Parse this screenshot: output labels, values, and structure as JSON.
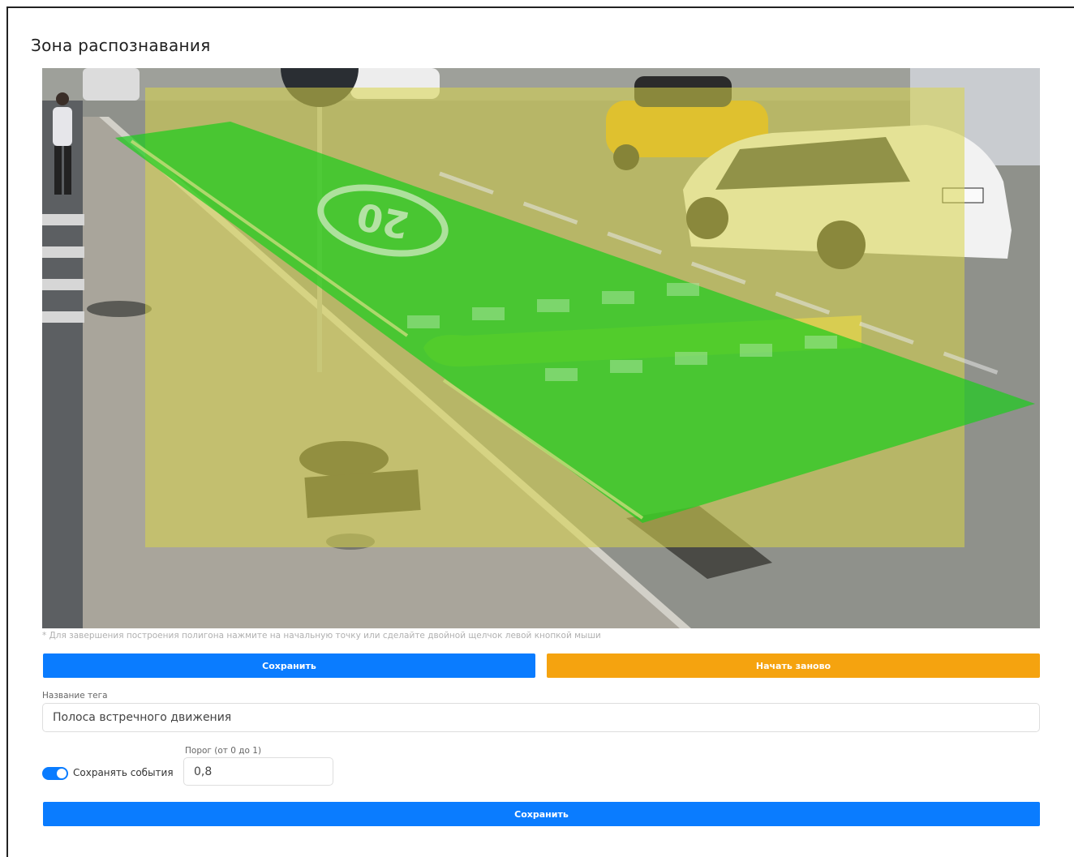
{
  "page": {
    "title": "Зона распознавания"
  },
  "camera": {
    "speed_marking": "20"
  },
  "hint": "* Для завершения построения полигона нажмите на начальную точку или сделайте двойной щелчок левой кнопкой мыши",
  "polygon_actions": {
    "save_label": "Сохранить",
    "restart_label": "Начать заново"
  },
  "tag": {
    "label": "Название тега",
    "value": "Полоса встречного движения"
  },
  "events": {
    "toggle_label": "Сохранять события",
    "toggle_on": true,
    "threshold_label": "Порог (от 0 до 1)",
    "threshold_value": "0,8"
  },
  "footer": {
    "save_label": "Сохранить"
  },
  "colors": {
    "primary": "#0a7cff",
    "warning": "#f5a30f",
    "zone_fill": "#1fcc1f",
    "roi_fill": "#d8d64a"
  }
}
